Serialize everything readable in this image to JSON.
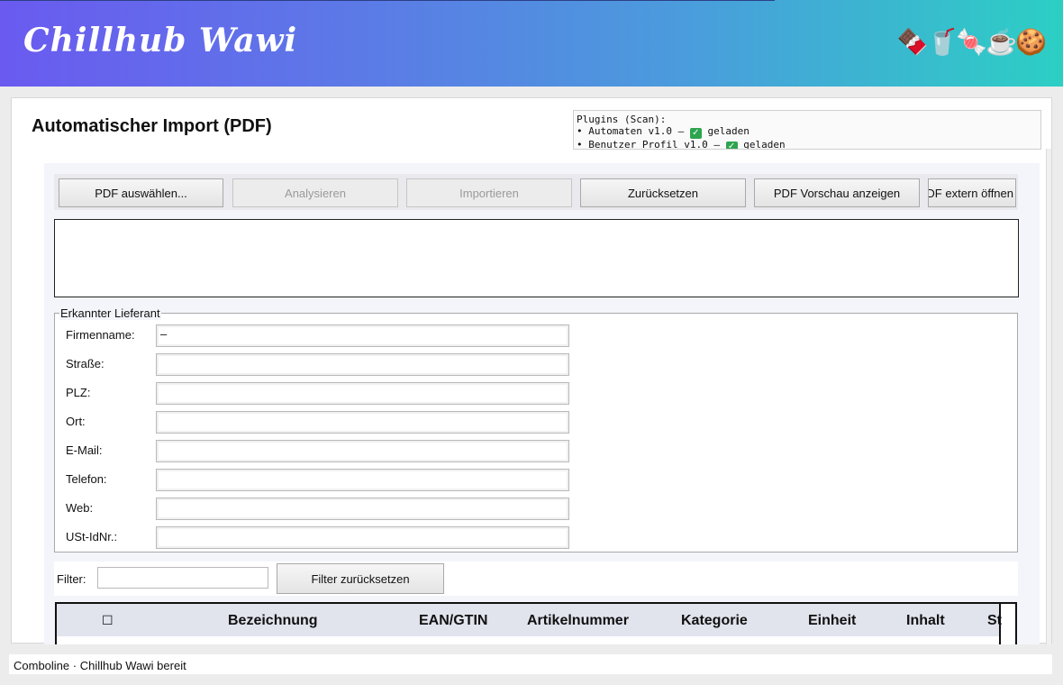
{
  "app": {
    "title": "Chillhub Wawi",
    "decor_snacks": "🍫🥤🍬☕🍪"
  },
  "page": {
    "title": "Automatischer Import (PDF)"
  },
  "plugins": {
    "header": "Plugins (Scan):",
    "items": [
      {
        "bullet": "•",
        "name": "Automaten v1.0 –",
        "status": "geladen"
      },
      {
        "bullet": "•",
        "name": "Benutzer Profil v1.0 –",
        "status": "geladen"
      }
    ]
  },
  "toolbar": {
    "pick_pdf": "PDF auswählen...",
    "analyze": "Analysieren",
    "import": "Importieren",
    "reset": "Zurücksetzen",
    "preview": "PDF Vorschau anzeigen",
    "open_external": "PDF extern öffnen"
  },
  "supplier": {
    "legend": "Erkannter Lieferant",
    "fields": [
      {
        "label": "Firmenname:",
        "value": "–"
      },
      {
        "label": "Straße:",
        "value": ""
      },
      {
        "label": "PLZ:",
        "value": ""
      },
      {
        "label": "Ort:",
        "value": ""
      },
      {
        "label": "E-Mail:",
        "value": ""
      },
      {
        "label": "Telefon:",
        "value": ""
      },
      {
        "label": "Web:",
        "value": ""
      },
      {
        "label": "USt-IdNr.:",
        "value": ""
      }
    ]
  },
  "filter": {
    "label": "Filter:",
    "value": "",
    "reset_label": "Filter zurücksetzen"
  },
  "table": {
    "columns": [
      "☐",
      "Bezeichnung",
      "EAN/GTIN",
      "Artikelnummer",
      "Kategorie",
      "Einheit",
      "Inhalt",
      "St"
    ]
  },
  "status": {
    "text": "Comboline · Chillhub Wawi bereit"
  },
  "colors": {
    "banner_start": "#6a5af0",
    "banner_end": "#2ccfc4",
    "check_green": "#2ea44f"
  }
}
